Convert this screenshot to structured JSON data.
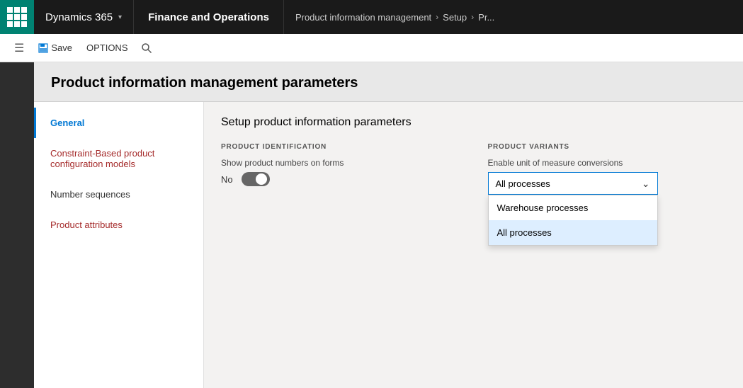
{
  "topNav": {
    "appLauncher": "app-launcher",
    "dynamics365": "Dynamics 365",
    "appName": "Finance and Operations",
    "breadcrumb": [
      "Product information management",
      "Setup",
      "Pr..."
    ]
  },
  "toolbar": {
    "menuIcon": "☰",
    "saveLabel": "Save",
    "optionsLabel": "OPTIONS",
    "searchIcon": "🔍"
  },
  "page": {
    "title": "Product information management parameters"
  },
  "leftTabs": [
    {
      "id": "general",
      "label": "General",
      "active": true
    },
    {
      "id": "constraint",
      "label": "Constraint-Based product configuration models",
      "active": false
    },
    {
      "id": "number-sequences",
      "label": "Number sequences",
      "active": false
    },
    {
      "id": "product-attributes",
      "label": "Product attributes",
      "active": false
    }
  ],
  "rightPanel": {
    "sectionTitle": "Setup product information parameters",
    "productIdentification": {
      "sectionLabel": "PRODUCT IDENTIFICATION",
      "showProductNumbersLabel": "Show product numbers on forms",
      "toggleValue": "No",
      "toggleOn": false
    },
    "productVariants": {
      "sectionLabel": "PRODUCT VARIANTS",
      "enableUnitLabel": "Enable unit of measure conversions",
      "selectedOption": "All processes",
      "options": [
        {
          "value": "warehouse",
          "label": "Warehouse processes"
        },
        {
          "value": "all",
          "label": "All processes"
        }
      ]
    }
  }
}
